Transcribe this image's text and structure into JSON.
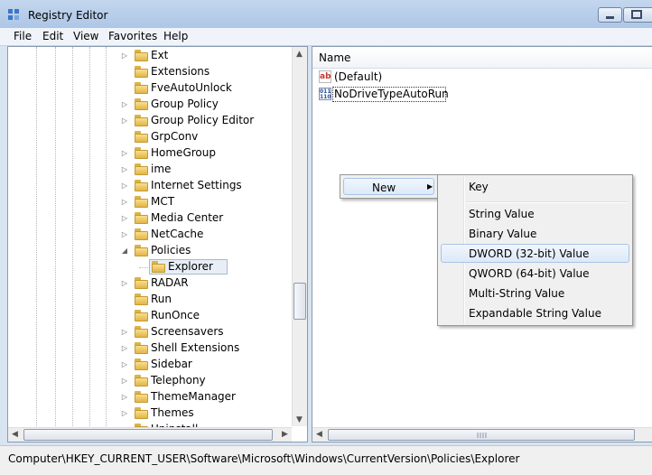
{
  "window": {
    "title": "Registry Editor",
    "icon": "registry-icon",
    "controls": [
      "minimize-icon",
      "maximize-icon"
    ]
  },
  "menubar": [
    "File",
    "Edit",
    "View",
    "Favorites",
    "Help"
  ],
  "tree": {
    "items": [
      {
        "label": "Ext",
        "expander": "collapsed",
        "selected": false
      },
      {
        "label": "Extensions",
        "expander": "none",
        "selected": false
      },
      {
        "label": "FveAutoUnlock",
        "expander": "none",
        "selected": false
      },
      {
        "label": "Group Policy",
        "expander": "collapsed",
        "selected": false
      },
      {
        "label": "Group Policy Editor",
        "expander": "collapsed",
        "selected": false
      },
      {
        "label": "GrpConv",
        "expander": "none",
        "selected": false
      },
      {
        "label": "HomeGroup",
        "expander": "collapsed",
        "selected": false
      },
      {
        "label": "ime",
        "expander": "collapsed",
        "selected": false
      },
      {
        "label": "Internet Settings",
        "expander": "collapsed",
        "selected": false
      },
      {
        "label": "MCT",
        "expander": "collapsed",
        "selected": false
      },
      {
        "label": "Media Center",
        "expander": "collapsed",
        "selected": false
      },
      {
        "label": "NetCache",
        "expander": "collapsed",
        "selected": false
      },
      {
        "label": "Policies",
        "expander": "expanded",
        "selected": false
      },
      {
        "label": "Explorer",
        "expander": "none",
        "selected": true,
        "child": true
      },
      {
        "label": "RADAR",
        "expander": "collapsed",
        "selected": false
      },
      {
        "label": "Run",
        "expander": "none",
        "selected": false
      },
      {
        "label": "RunOnce",
        "expander": "none",
        "selected": false
      },
      {
        "label": "Screensavers",
        "expander": "collapsed",
        "selected": false
      },
      {
        "label": "Shell Extensions",
        "expander": "collapsed",
        "selected": false
      },
      {
        "label": "Sidebar",
        "expander": "collapsed",
        "selected": false
      },
      {
        "label": "Telephony",
        "expander": "collapsed",
        "selected": false
      },
      {
        "label": "ThemeManager",
        "expander": "collapsed",
        "selected": false
      },
      {
        "label": "Themes",
        "expander": "collapsed",
        "selected": false
      },
      {
        "label": "Uninstall",
        "expander": "collapsed",
        "selected": false
      }
    ]
  },
  "list": {
    "column": "Name",
    "values": [
      {
        "name": "(Default)",
        "icon": "string-value-icon"
      },
      {
        "name": "NoDriveTypeAutoRun",
        "icon": "binary-value-icon",
        "focused": true
      }
    ]
  },
  "context_menu": {
    "item": "New",
    "submenu_arrow": "▶"
  },
  "submenu": {
    "items": [
      "Key",
      "String Value",
      "Binary Value",
      "DWORD (32-bit) Value",
      "QWORD (64-bit) Value",
      "Multi-String Value",
      "Expandable String Value"
    ],
    "highlighted": "DWORD (32-bit) Value"
  },
  "status": {
    "path": "Computer\\HKEY_CURRENT_USER\\Software\\Microsoft\\Windows\\CurrentVersion\\Policies\\Explorer"
  },
  "colors": {
    "title_bar": "#b9cfea",
    "highlight": "#dce9f8",
    "folder": "#e9c35a"
  }
}
